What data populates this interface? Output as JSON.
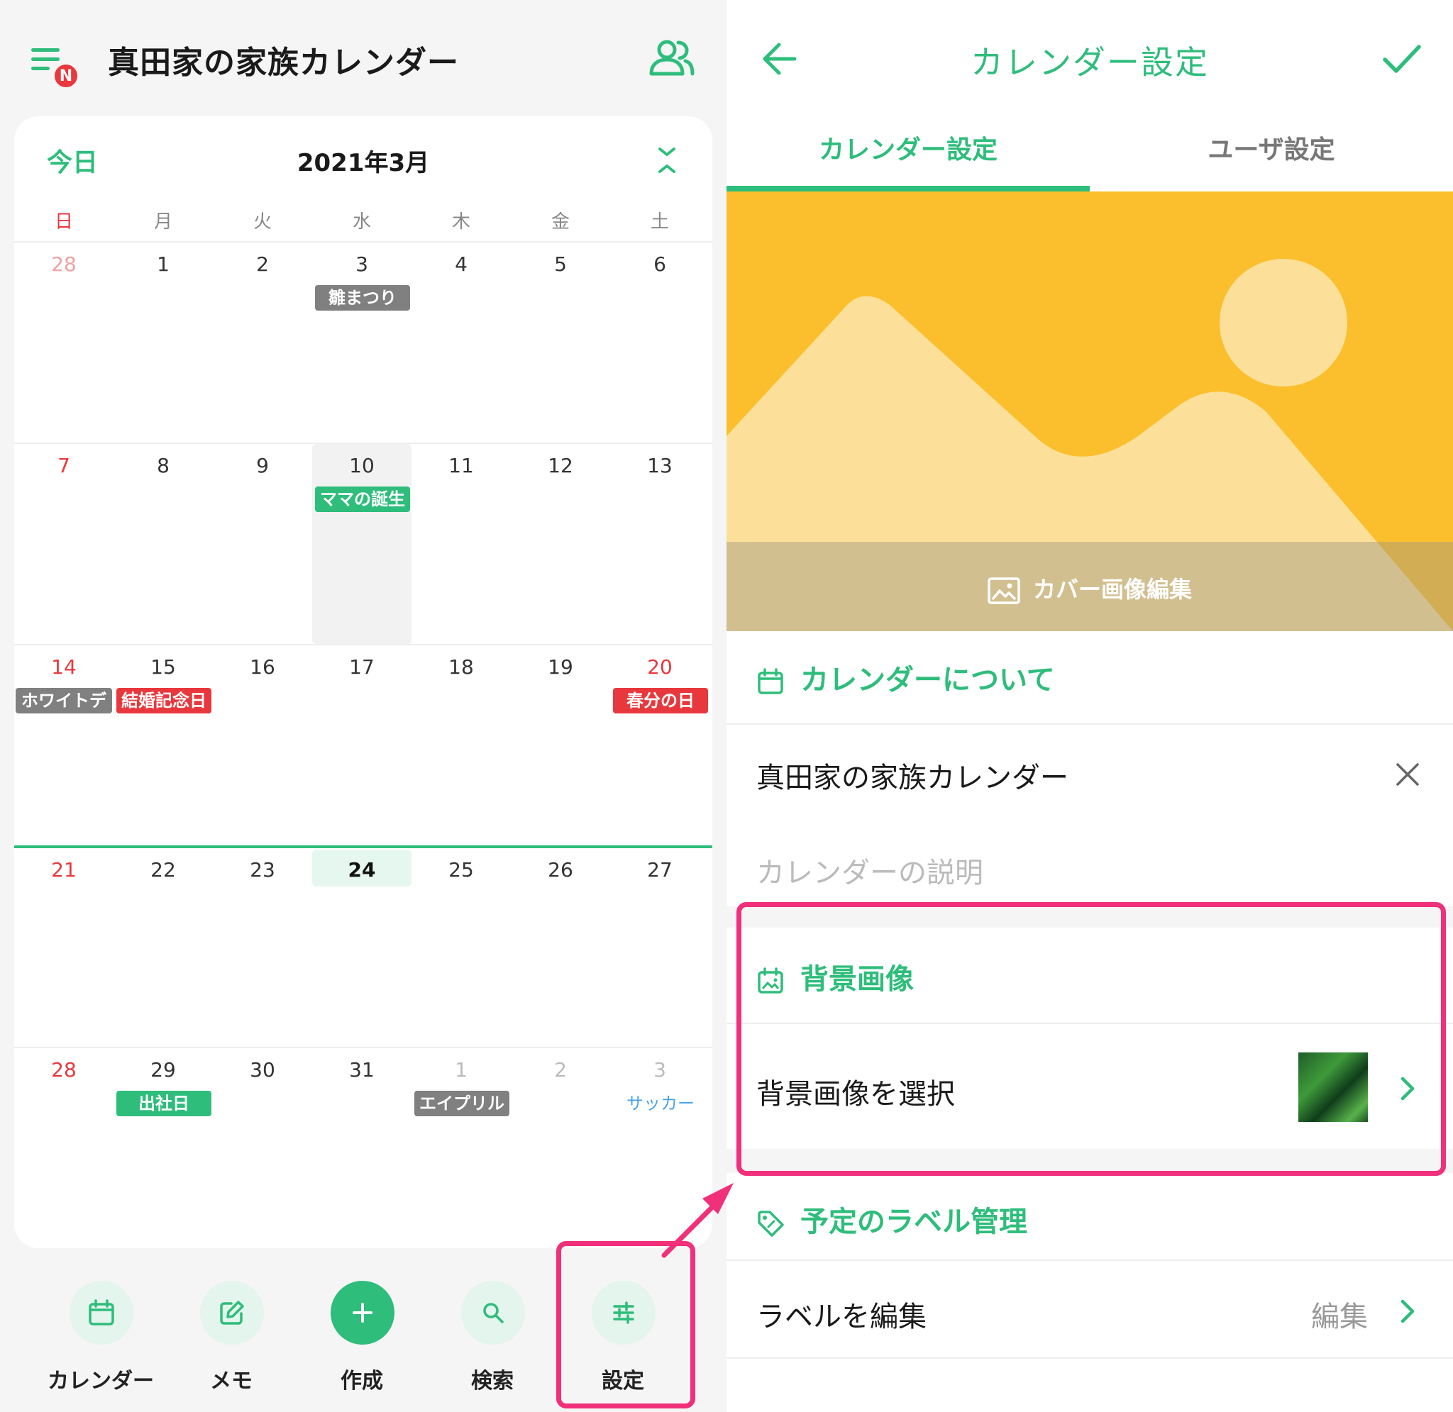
{
  "left": {
    "header": {
      "title": "真田家の家族カレンダー",
      "badge": "N"
    },
    "calendar": {
      "today_label": "今日",
      "month_label": "2021年3月",
      "weekdays": [
        "日",
        "月",
        "火",
        "水",
        "木",
        "金",
        "土"
      ],
      "weeks": [
        {
          "days": [
            "28",
            "1",
            "2",
            "3",
            "4",
            "5",
            "6"
          ]
        },
        {
          "days": [
            "7",
            "8",
            "9",
            "10",
            "11",
            "12",
            "13"
          ]
        },
        {
          "days": [
            "14",
            "15",
            "16",
            "17",
            "18",
            "19",
            "20"
          ]
        },
        {
          "days": [
            "21",
            "22",
            "23",
            "24",
            "25",
            "26",
            "27"
          ]
        },
        {
          "days": [
            "28",
            "29",
            "30",
            "31",
            "1",
            "2",
            "3"
          ]
        }
      ],
      "events": {
        "hinamatsuri": "雛まつり",
        "mama_birthday": "ママの誕生",
        "white_day": "ホワイトデ",
        "wedding_anniv": "結婚記念日",
        "shunbun": "春分の日",
        "shusha": "出社日",
        "april": "エイプリル",
        "soccer": "サッカー"
      }
    },
    "bottom_nav": {
      "calendar": "カレンダー",
      "memo": "メモ",
      "create": "作成",
      "search": "検索",
      "settings": "設定"
    }
  },
  "right": {
    "header": {
      "title": "カレンダー設定"
    },
    "tabs": {
      "calendar": "カレンダー設定",
      "user": "ユーザ設定"
    },
    "cover": {
      "edit_label": "カバー画像編集"
    },
    "about": {
      "heading": "カレンダーについて",
      "name_value": "真田家の家族カレンダー",
      "description_placeholder": "カレンダーの説明"
    },
    "background": {
      "heading": "背景画像",
      "select_label": "背景画像を選択"
    },
    "labels": {
      "heading": "予定のラベル管理",
      "edit_row": "ラベルを編集",
      "edit_value": "編集"
    }
  },
  "colors": {
    "accent": "#2ebd7b",
    "sunday_red": "#e8383d",
    "highlight_pink": "#f0307a",
    "cover_yellow": "#fbbf2d"
  }
}
